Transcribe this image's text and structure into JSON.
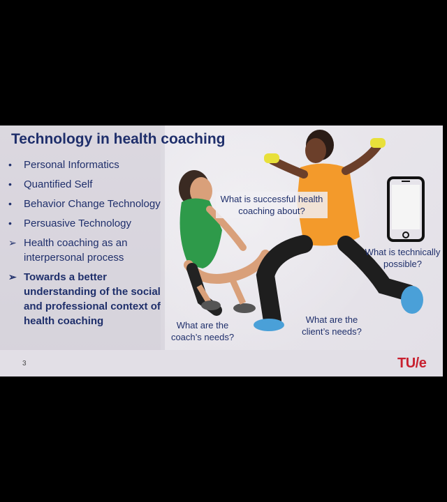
{
  "slide": {
    "title": "Technology in health coaching",
    "bullets": [
      {
        "marker": "•",
        "text": "Personal Informatics",
        "bold": false
      },
      {
        "marker": "•",
        "text": "Quantified Self",
        "bold": false
      },
      {
        "marker": "•",
        "text": "Behavior Change Technology",
        "bold": false
      },
      {
        "marker": "•",
        "text": "Persuasive Technology",
        "bold": false
      },
      {
        "marker": "➢",
        "text": "Health coaching as an interpersonal process",
        "bold": false
      },
      {
        "marker": "➢",
        "text": "Towards a better understanding of the social and professional context of health coaching",
        "bold": true
      }
    ],
    "questions": {
      "successful": "What is successful health coaching about?",
      "technical": "What is technically possible?",
      "coach": "What are the coach’s needs?",
      "client": "What are the client’s needs?"
    },
    "page_number": "3",
    "logo": "TU/e",
    "icons": {
      "phone": "smartphone-icon",
      "illustration": "coach-and-client-exercise-illustration"
    },
    "colors": {
      "title": "#1f2f6b",
      "logo": "#c8202f",
      "coach_shirt": "#2e9a4a",
      "client_shirt": "#f39a2b"
    }
  }
}
